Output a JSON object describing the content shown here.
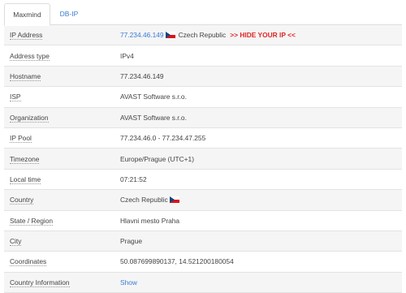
{
  "tabs": [
    {
      "label": "Maxmind"
    },
    {
      "label": "DB-IP"
    }
  ],
  "rows": [
    {
      "label": "IP Address",
      "ip": "77.234.46.149",
      "country": "Czech Republic",
      "hide": ">> HIDE YOUR IP <<"
    },
    {
      "label": "Address type",
      "value": "IPv4"
    },
    {
      "label": "Hostname",
      "value": "77.234.46.149"
    },
    {
      "label": "ISP",
      "value": "AVAST Software s.r.o."
    },
    {
      "label": "Organization",
      "value": "AVAST Software s.r.o."
    },
    {
      "label": "IP Pool",
      "value": "77.234.46.0 - 77.234.47.255"
    },
    {
      "label": "Timezone",
      "value": "Europe/Prague (UTC+1)"
    },
    {
      "label": "Local time",
      "value": "07:21:52"
    },
    {
      "label": "Country",
      "value": "Czech Republic"
    },
    {
      "label": "State / Region",
      "value": "Hlavni mesto Praha"
    },
    {
      "label": "City",
      "value": "Prague"
    },
    {
      "label": "Coordinates",
      "value": "50.087699890137, 14.521200180054"
    },
    {
      "label": "Country Information",
      "value": "Show"
    }
  ],
  "colors": {
    "link": "#3a7bd5",
    "hide": "#e02424",
    "row_alt": "#f5f5f5"
  },
  "icons": [
    "czech-flag-icon"
  ]
}
